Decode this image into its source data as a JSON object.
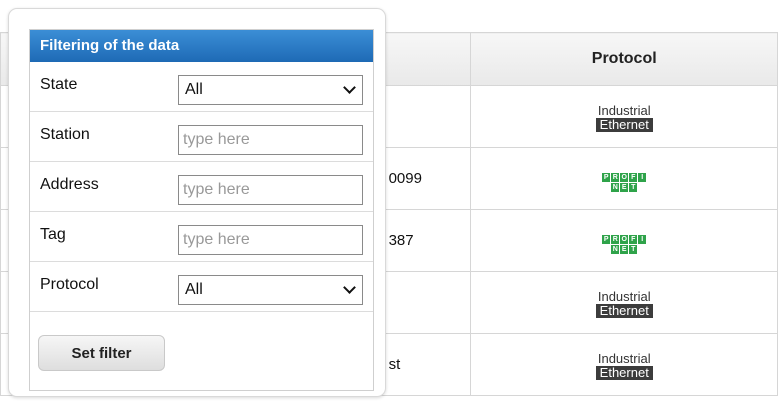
{
  "table": {
    "header": {
      "col_a": "",
      "col_b": "",
      "col_c": "Protocol"
    },
    "rows": [
      {
        "col_b": "",
        "protocol": "industrial-ethernet"
      },
      {
        "col_b": "0099",
        "protocol": "profinet"
      },
      {
        "col_b": "387",
        "protocol": "profinet"
      },
      {
        "col_b": "",
        "protocol": "industrial-ethernet"
      },
      {
        "col_b": "st",
        "protocol": "industrial-ethernet"
      }
    ],
    "industrial_ethernet": {
      "top": "Industrial",
      "bottom": "Ethernet"
    },
    "profinet": {
      "top": "PROFI",
      "bottom": "NET"
    }
  },
  "filter": {
    "title": "Filtering of the data",
    "fields": {
      "state": {
        "label": "State",
        "value": "All"
      },
      "station": {
        "label": "Station",
        "placeholder": "type here"
      },
      "address": {
        "label": "Address",
        "placeholder": "type here"
      },
      "tag": {
        "label": "Tag",
        "placeholder": "type here"
      },
      "protocol": {
        "label": "Protocol",
        "value": "All"
      }
    },
    "button": "Set filter"
  },
  "colors": {
    "title_bar": "#2a7cc7",
    "profinet_green": "#2fa34a"
  }
}
